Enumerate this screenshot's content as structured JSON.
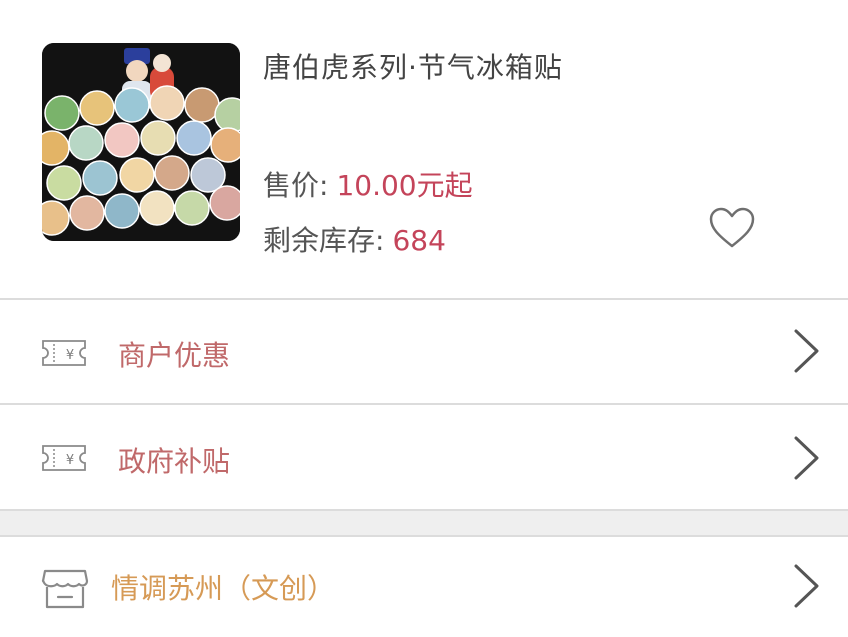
{
  "product": {
    "title": "唐伯虎系列·节气冰箱贴",
    "price_label": "售价:",
    "price_value": "10.00元起",
    "stock_label": "剩余库存:",
    "stock_value": "684",
    "thumbnail_icon": "product-photo",
    "favorite_icon": "heart-outline-icon"
  },
  "rows": [
    {
      "label": "商户优惠",
      "icon": "yuan-ticket-icon"
    },
    {
      "label": "政府补贴",
      "icon": "yuan-ticket-icon"
    }
  ],
  "shop": {
    "label": "情调苏州（文创）",
    "icon": "store-icon"
  },
  "colors": {
    "accent": "#c4445a",
    "row_text": "#c0696a",
    "shop_text": "#d69a56",
    "chevron": "#555555",
    "divider": "#dcdcdc"
  }
}
